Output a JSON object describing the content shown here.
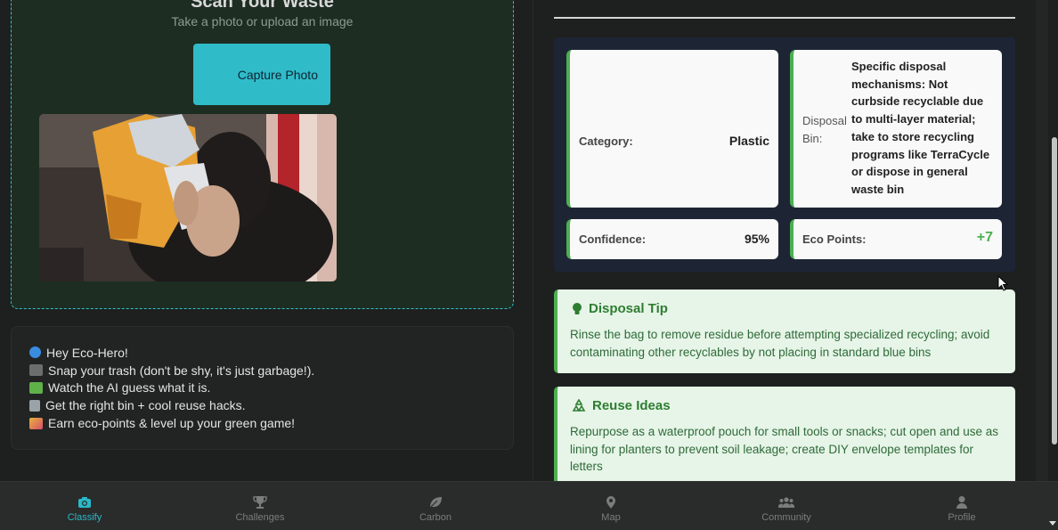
{
  "upload": {
    "title": "Scan Your Waste",
    "subtitle": "Take a photo or upload an image",
    "capture_label": "Capture Photo"
  },
  "intro": {
    "lines": [
      {
        "icon": "globe-icon",
        "text": "Hey Eco-Hero!"
      },
      {
        "icon": "camera-icon",
        "text": "Snap your trash (don't be shy, it's just garbage!)."
      },
      {
        "icon": "puzzle-icon",
        "text": "Watch the AI guess what it is."
      },
      {
        "icon": "trash-bin-icon",
        "text": "Get the right bin + cool reuse hacks."
      },
      {
        "icon": "party-icon",
        "text": "Earn eco-points & level up your green game!"
      }
    ]
  },
  "result": {
    "category_label": "Category:",
    "category_value": "Plastic",
    "bin_label": "Disposal Bin:",
    "bin_value": "Specific disposal mechanisms: Not curbside recyclable due to multi-layer material; take to store recycling programs like TerraCycle or dispose in general waste bin",
    "confidence_label": "Confidence:",
    "confidence_value": "95%",
    "points_label": "Eco Points:",
    "points_value": "+7"
  },
  "tips": {
    "disposal_title": "Disposal Tip",
    "disposal_text": "Rinse the bag to remove residue before attempting specialized recycling; avoid contaminating other recyclables by not placing in standard blue bins",
    "reuse_title": "Reuse Ideas",
    "reuse_text": "Repurpose as a waterproof pouch for small tools or snacks; cut open and use as lining for planters to prevent soil leakage; create DIY envelope templates for letters"
  },
  "nav": {
    "items": [
      {
        "label": "Classify",
        "icon": "camera-icon",
        "active": true
      },
      {
        "label": "Challenges",
        "icon": "trophy-icon",
        "active": false
      },
      {
        "label": "Carbon",
        "icon": "leaf-icon",
        "active": false
      },
      {
        "label": "Map",
        "icon": "map-pin-icon",
        "active": false
      },
      {
        "label": "Community",
        "icon": "users-icon",
        "active": false
      },
      {
        "label": "Profile",
        "icon": "user-icon",
        "active": false
      }
    ]
  },
  "colors": {
    "accent": "#2ec4cc",
    "success": "#4caf50",
    "points": "#4caf50"
  }
}
